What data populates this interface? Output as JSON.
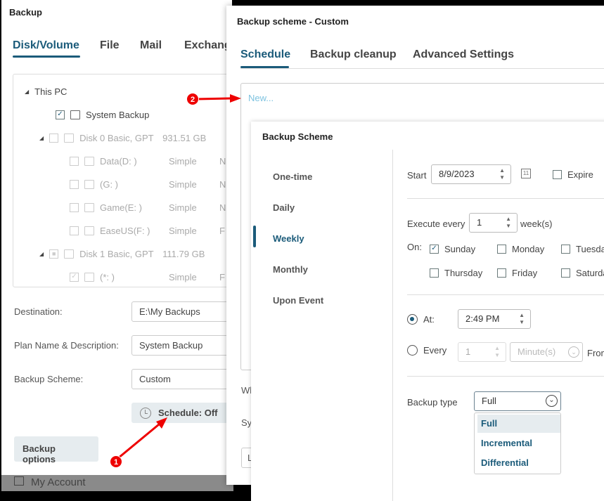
{
  "main": {
    "title": "Backup",
    "tabs": [
      "Disk/Volume",
      "File",
      "Mail",
      "Exchange"
    ],
    "tree": {
      "root": "This PC",
      "items": [
        {
          "name": "System Backup",
          "size": "",
          "type": "",
          "fs": "",
          "checked": true,
          "level": 1
        },
        {
          "name": "Disk 0 Basic, GPT",
          "size": "931.51 GB",
          "type": "",
          "fs": "",
          "checked": false,
          "level": 1
        },
        {
          "name": "Data(D: )",
          "size": "",
          "type": "Simple",
          "fs": "N",
          "checked": false,
          "level": 2
        },
        {
          "name": "(G: )",
          "size": "",
          "type": "Simple",
          "fs": "N",
          "checked": false,
          "level": 2
        },
        {
          "name": "Game(E: )",
          "size": "",
          "type": "Simple",
          "fs": "N",
          "checked": false,
          "level": 2
        },
        {
          "name": "EaseUS(F: )",
          "size": "",
          "type": "Simple",
          "fs": "F",
          "checked": false,
          "level": 2
        },
        {
          "name": "Disk 1 Basic, GPT",
          "size": "111.79 GB",
          "type": "",
          "fs": "",
          "checked": "partial",
          "level": 1
        },
        {
          "name": "(*: )",
          "size": "",
          "type": "Simple",
          "fs": "F",
          "checked": true,
          "level": 2
        }
      ]
    },
    "destination_label": "Destination:",
    "destination": "E:\\My Backups",
    "plan_label": "Plan Name & Description:",
    "plan": "System Backup",
    "scheme_label": "Backup Scheme:",
    "scheme": "Custom",
    "schedule_button": "Schedule: Off",
    "backup_options": "Backup options",
    "my_account": "My Account"
  },
  "dialog": {
    "title": "Backup scheme - Custom",
    "tabs": [
      "Schedule",
      "Backup cleanup",
      "Advanced Settings"
    ],
    "active_tab": 0,
    "new_link": "New...",
    "partial_1": "Wh",
    "partial_2": "Sys",
    "partial_3": "L"
  },
  "scheme": {
    "title": "Backup Scheme",
    "nav": [
      "One-time",
      "Daily",
      "Weekly",
      "Monthly",
      "Upon Event"
    ],
    "active": 2,
    "start_label": "Start",
    "start_date": "8/9/2023",
    "expire_label": "Expire",
    "expire_checked": false,
    "execute_label": "Execute every",
    "execute_value": "1",
    "execute_unit": "week(s)",
    "on_label": "On:",
    "days": [
      {
        "name": "Sunday",
        "checked": true
      },
      {
        "name": "Monday",
        "checked": false
      },
      {
        "name": "Tuesday",
        "checked": false
      },
      {
        "name": "Thursday",
        "checked": false
      },
      {
        "name": "Friday",
        "checked": false
      },
      {
        "name": "Saturday",
        "checked": false
      }
    ],
    "at_label": "At:",
    "at_value": "2:49 PM",
    "at_selected": true,
    "every_label": "Every",
    "every_value": "1",
    "every_unit": "Minute(s)",
    "from_label": "From",
    "backup_type_label": "Backup type",
    "backup_type": "Full",
    "backup_type_options": [
      "Full",
      "Incremental",
      "Differential"
    ]
  },
  "annotations": [
    "1",
    "2"
  ],
  "colors": {
    "accent": "#1b5b7a",
    "link": "#7ec3e0",
    "annotation": "#e00000"
  }
}
